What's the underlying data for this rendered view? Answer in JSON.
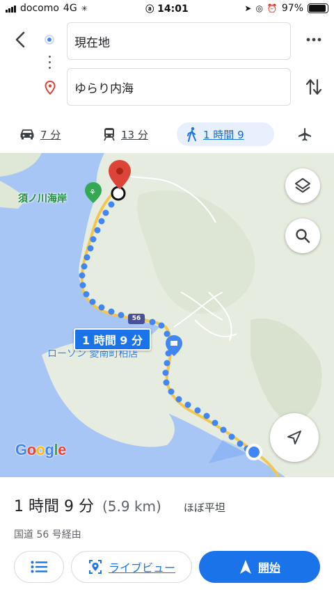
{
  "status_bar": {
    "carrier": "docomo",
    "network": "4G",
    "time": "14:01",
    "battery": "97%"
  },
  "header": {
    "origin_value": "現在地",
    "destination_value": "ゆらり内海",
    "modes": [
      {
        "name": "drive",
        "label": "7 分",
        "icon": "car-icon"
      },
      {
        "name": "transit",
        "label": "13 分",
        "icon": "train-icon"
      },
      {
        "name": "walk",
        "label": "1 時間 9",
        "icon": "walk-icon",
        "selected": true
      },
      {
        "name": "fly",
        "label": "",
        "icon": "airplane-icon"
      }
    ]
  },
  "map": {
    "poi_beach": "須ノ川海岸",
    "store_label": "ローソン 愛南町柏店",
    "route_number": "56",
    "duration_callout": "1 時間 9 分",
    "logo": "Google",
    "colors": {
      "water": "#a7c5f5",
      "land": "#e6ecdf",
      "route": "#4285f4",
      "destination_pin": "#db4437"
    }
  },
  "sheet": {
    "time_label": "1 時間 9 分",
    "distance": "(5.9 km)",
    "terrain": "ほぼ平坦",
    "via": "国道 56 号経由",
    "live_view_label": "ライブビュー",
    "start_label": "開始"
  }
}
